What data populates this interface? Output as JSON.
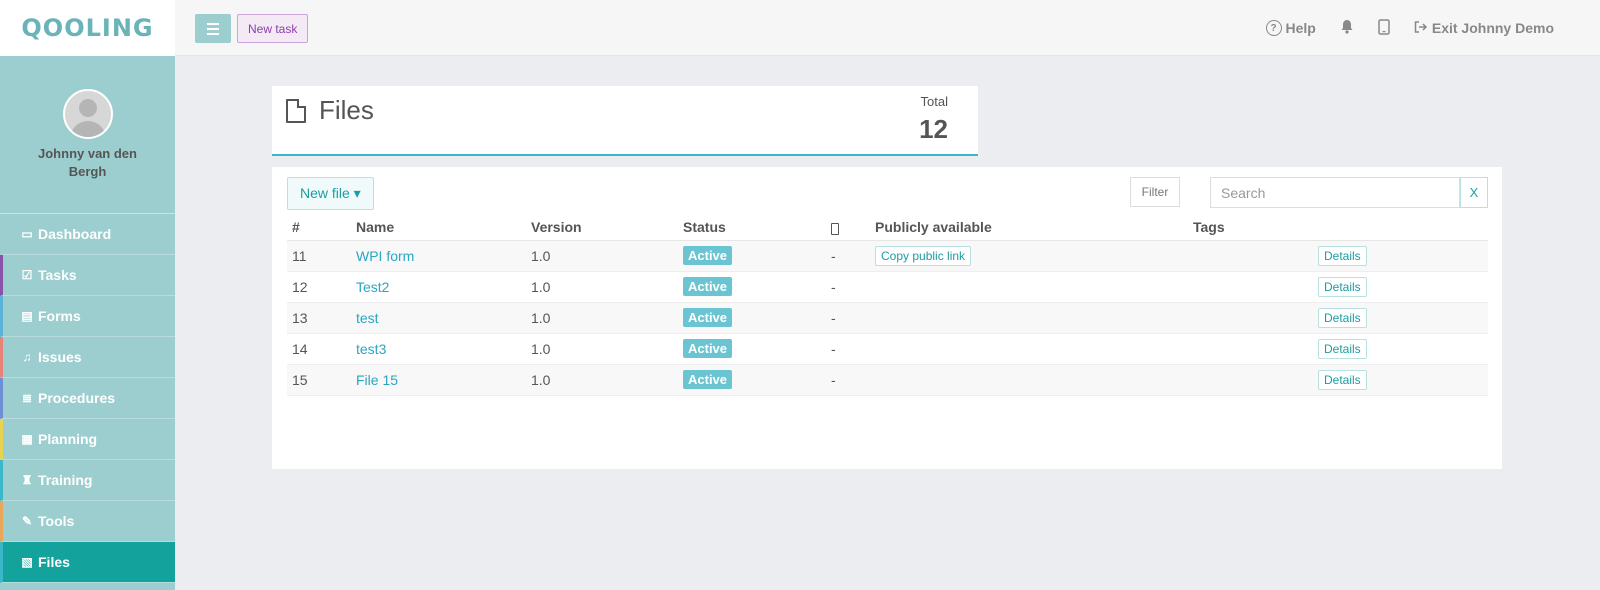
{
  "brand": {
    "logo_text": "QOOLING"
  },
  "profile": {
    "name": "Johnny van den Bergh"
  },
  "sidebar": {
    "items": [
      {
        "label": "Dashboard",
        "icon": "monitor-icon",
        "glyph": "▭",
        "accent": "#9cced0"
      },
      {
        "label": "Tasks",
        "icon": "checkbox-icon",
        "glyph": "☑",
        "accent": "#8a52a8"
      },
      {
        "label": "Forms",
        "icon": "document-icon",
        "glyph": "▤",
        "accent": "#5ab3d6"
      },
      {
        "label": "Issues",
        "icon": "bell-icon",
        "glyph": "♫",
        "accent": "#e8837a"
      },
      {
        "label": "Procedures",
        "icon": "list-icon",
        "glyph": "≣",
        "accent": "#6e8fd1"
      },
      {
        "label": "Planning",
        "icon": "calendar-icon",
        "glyph": "▦",
        "accent": "#e8d24f"
      },
      {
        "label": "Training",
        "icon": "graduation-cap-icon",
        "glyph": "♜",
        "accent": "#3ab7c8"
      },
      {
        "label": "Tools",
        "icon": "wrench-icon",
        "glyph": "✎",
        "accent": "#e8a65a"
      },
      {
        "label": "Files",
        "icon": "pdf-file-icon",
        "glyph": "▧",
        "accent": "#3ab7c8",
        "active": true
      }
    ]
  },
  "topbar": {
    "new_task_label": "New task",
    "help_label": "Help",
    "exit_label": "Exit Johnny Demo"
  },
  "summary": {
    "title": "Files",
    "total_label": "Total",
    "total_value": "12"
  },
  "toolbar": {
    "new_file_label": "New file ▾",
    "filter_label": "Filter",
    "search_placeholder": "Search",
    "clear_label": "X"
  },
  "table": {
    "headers": [
      "#",
      "Name",
      "Version",
      "Status",
      "",
      "Publicly available",
      "Tags",
      ""
    ],
    "rows": [
      {
        "id": "11",
        "name": "WPI form",
        "version": "1.0",
        "status": "Active",
        "mobile": "-",
        "public_action": "Copy public link",
        "tags": "",
        "details": "Details"
      },
      {
        "id": "12",
        "name": "Test2",
        "version": "1.0",
        "status": "Active",
        "mobile": "-",
        "public_action": "",
        "tags": "",
        "details": "Details"
      },
      {
        "id": "13",
        "name": "test",
        "version": "1.0",
        "status": "Active",
        "mobile": "-",
        "public_action": "",
        "tags": "",
        "details": "Details"
      },
      {
        "id": "14",
        "name": "test3",
        "version": "1.0",
        "status": "Active",
        "mobile": "-",
        "public_action": "",
        "tags": "",
        "details": "Details"
      },
      {
        "id": "15",
        "name": "File 15",
        "version": "1.0",
        "status": "Active",
        "mobile": "-",
        "public_action": "",
        "tags": "",
        "details": "Details"
      }
    ]
  }
}
